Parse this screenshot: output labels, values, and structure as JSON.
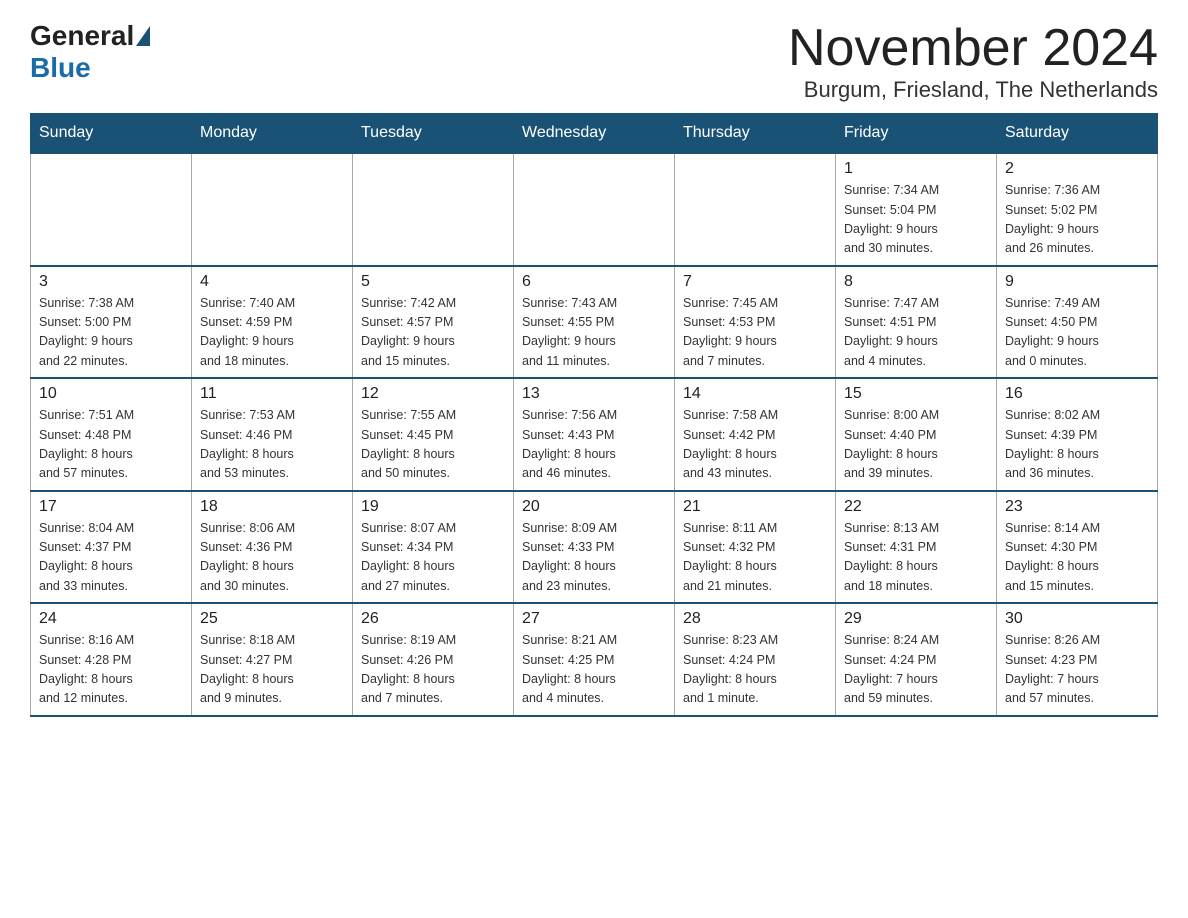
{
  "header": {
    "logo_general": "General",
    "logo_blue": "Blue",
    "month_title": "November 2024",
    "location": "Burgum, Friesland, The Netherlands"
  },
  "days_of_week": [
    "Sunday",
    "Monday",
    "Tuesday",
    "Wednesday",
    "Thursday",
    "Friday",
    "Saturday"
  ],
  "weeks": [
    [
      {
        "day": "",
        "info": ""
      },
      {
        "day": "",
        "info": ""
      },
      {
        "day": "",
        "info": ""
      },
      {
        "day": "",
        "info": ""
      },
      {
        "day": "",
        "info": ""
      },
      {
        "day": "1",
        "info": "Sunrise: 7:34 AM\nSunset: 5:04 PM\nDaylight: 9 hours\nand 30 minutes."
      },
      {
        "day": "2",
        "info": "Sunrise: 7:36 AM\nSunset: 5:02 PM\nDaylight: 9 hours\nand 26 minutes."
      }
    ],
    [
      {
        "day": "3",
        "info": "Sunrise: 7:38 AM\nSunset: 5:00 PM\nDaylight: 9 hours\nand 22 minutes."
      },
      {
        "day": "4",
        "info": "Sunrise: 7:40 AM\nSunset: 4:59 PM\nDaylight: 9 hours\nand 18 minutes."
      },
      {
        "day": "5",
        "info": "Sunrise: 7:42 AM\nSunset: 4:57 PM\nDaylight: 9 hours\nand 15 minutes."
      },
      {
        "day": "6",
        "info": "Sunrise: 7:43 AM\nSunset: 4:55 PM\nDaylight: 9 hours\nand 11 minutes."
      },
      {
        "day": "7",
        "info": "Sunrise: 7:45 AM\nSunset: 4:53 PM\nDaylight: 9 hours\nand 7 minutes."
      },
      {
        "day": "8",
        "info": "Sunrise: 7:47 AM\nSunset: 4:51 PM\nDaylight: 9 hours\nand 4 minutes."
      },
      {
        "day": "9",
        "info": "Sunrise: 7:49 AM\nSunset: 4:50 PM\nDaylight: 9 hours\nand 0 minutes."
      }
    ],
    [
      {
        "day": "10",
        "info": "Sunrise: 7:51 AM\nSunset: 4:48 PM\nDaylight: 8 hours\nand 57 minutes."
      },
      {
        "day": "11",
        "info": "Sunrise: 7:53 AM\nSunset: 4:46 PM\nDaylight: 8 hours\nand 53 minutes."
      },
      {
        "day": "12",
        "info": "Sunrise: 7:55 AM\nSunset: 4:45 PM\nDaylight: 8 hours\nand 50 minutes."
      },
      {
        "day": "13",
        "info": "Sunrise: 7:56 AM\nSunset: 4:43 PM\nDaylight: 8 hours\nand 46 minutes."
      },
      {
        "day": "14",
        "info": "Sunrise: 7:58 AM\nSunset: 4:42 PM\nDaylight: 8 hours\nand 43 minutes."
      },
      {
        "day": "15",
        "info": "Sunrise: 8:00 AM\nSunset: 4:40 PM\nDaylight: 8 hours\nand 39 minutes."
      },
      {
        "day": "16",
        "info": "Sunrise: 8:02 AM\nSunset: 4:39 PM\nDaylight: 8 hours\nand 36 minutes."
      }
    ],
    [
      {
        "day": "17",
        "info": "Sunrise: 8:04 AM\nSunset: 4:37 PM\nDaylight: 8 hours\nand 33 minutes."
      },
      {
        "day": "18",
        "info": "Sunrise: 8:06 AM\nSunset: 4:36 PM\nDaylight: 8 hours\nand 30 minutes."
      },
      {
        "day": "19",
        "info": "Sunrise: 8:07 AM\nSunset: 4:34 PM\nDaylight: 8 hours\nand 27 minutes."
      },
      {
        "day": "20",
        "info": "Sunrise: 8:09 AM\nSunset: 4:33 PM\nDaylight: 8 hours\nand 23 minutes."
      },
      {
        "day": "21",
        "info": "Sunrise: 8:11 AM\nSunset: 4:32 PM\nDaylight: 8 hours\nand 21 minutes."
      },
      {
        "day": "22",
        "info": "Sunrise: 8:13 AM\nSunset: 4:31 PM\nDaylight: 8 hours\nand 18 minutes."
      },
      {
        "day": "23",
        "info": "Sunrise: 8:14 AM\nSunset: 4:30 PM\nDaylight: 8 hours\nand 15 minutes."
      }
    ],
    [
      {
        "day": "24",
        "info": "Sunrise: 8:16 AM\nSunset: 4:28 PM\nDaylight: 8 hours\nand 12 minutes."
      },
      {
        "day": "25",
        "info": "Sunrise: 8:18 AM\nSunset: 4:27 PM\nDaylight: 8 hours\nand 9 minutes."
      },
      {
        "day": "26",
        "info": "Sunrise: 8:19 AM\nSunset: 4:26 PM\nDaylight: 8 hours\nand 7 minutes."
      },
      {
        "day": "27",
        "info": "Sunrise: 8:21 AM\nSunset: 4:25 PM\nDaylight: 8 hours\nand 4 minutes."
      },
      {
        "day": "28",
        "info": "Sunrise: 8:23 AM\nSunset: 4:24 PM\nDaylight: 8 hours\nand 1 minute."
      },
      {
        "day": "29",
        "info": "Sunrise: 8:24 AM\nSunset: 4:24 PM\nDaylight: 7 hours\nand 59 minutes."
      },
      {
        "day": "30",
        "info": "Sunrise: 8:26 AM\nSunset: 4:23 PM\nDaylight: 7 hours\nand 57 minutes."
      }
    ]
  ]
}
